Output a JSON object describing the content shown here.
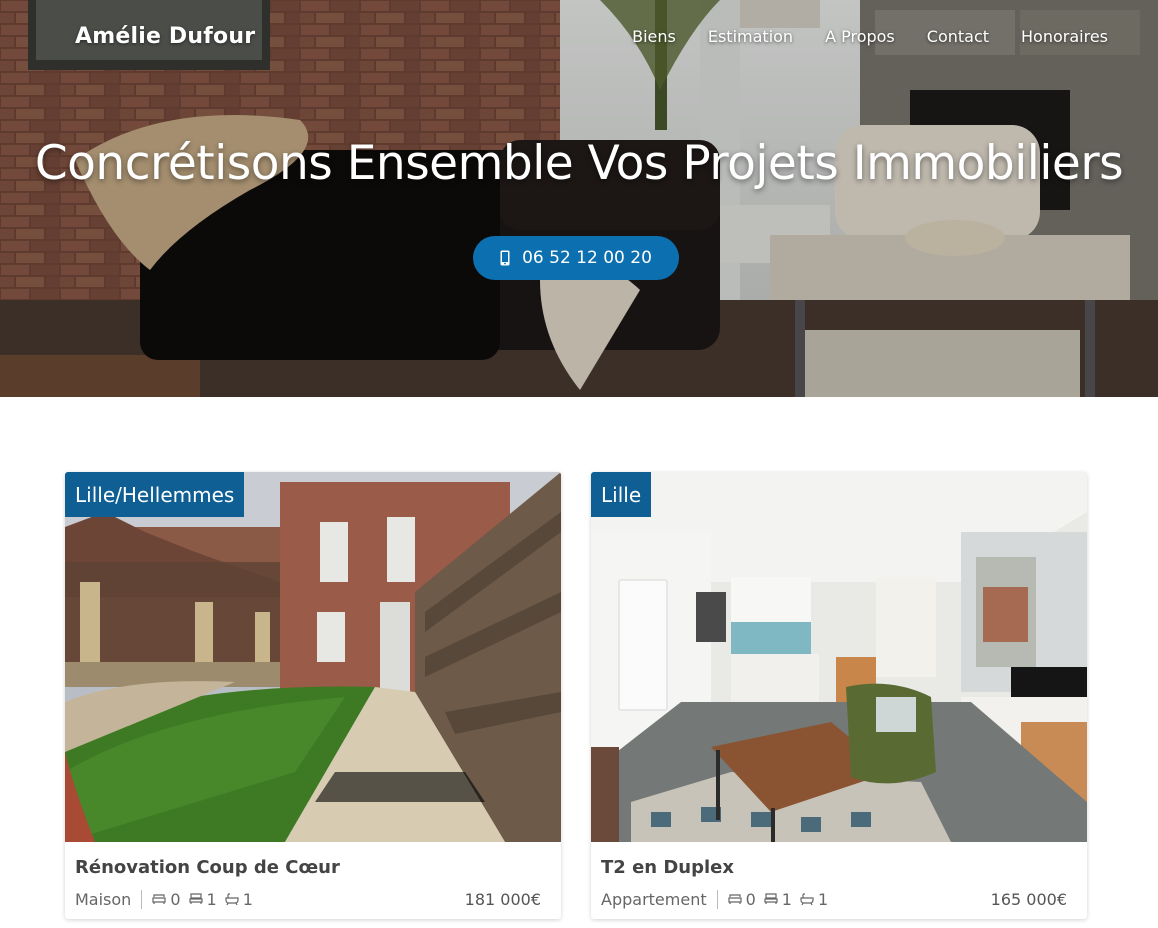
{
  "header": {
    "brand": "Amélie Dufour",
    "menu": [
      "Biens",
      "Estimation",
      "A Propos",
      "Contact",
      "Honoraires"
    ]
  },
  "hero": {
    "title": "Concrétisons Ensemble Vos Projets Immobiliers",
    "phone": "06 52 12 00 20"
  },
  "listings": [
    {
      "city": "Lille/Hellemmes",
      "title": "Rénovation Coup de Cœur",
      "type": "Maison",
      "rooms": "0",
      "bedrooms": "1",
      "bathrooms": "1",
      "price": "181 000€"
    },
    {
      "city": "Lille",
      "title": "T2 en Duplex",
      "type": "Appartement",
      "rooms": "0",
      "bedrooms": "1",
      "bathrooms": "1",
      "price": "165 000€"
    }
  ],
  "colors": {
    "accent": "#0c6fb0",
    "city_badge": "#0f5f95"
  },
  "icons": {
    "phone": "mobile-phone-icon",
    "rooms": "sofa-icon",
    "bedrooms": "bed-icon",
    "bathrooms": "bathtub-icon"
  }
}
